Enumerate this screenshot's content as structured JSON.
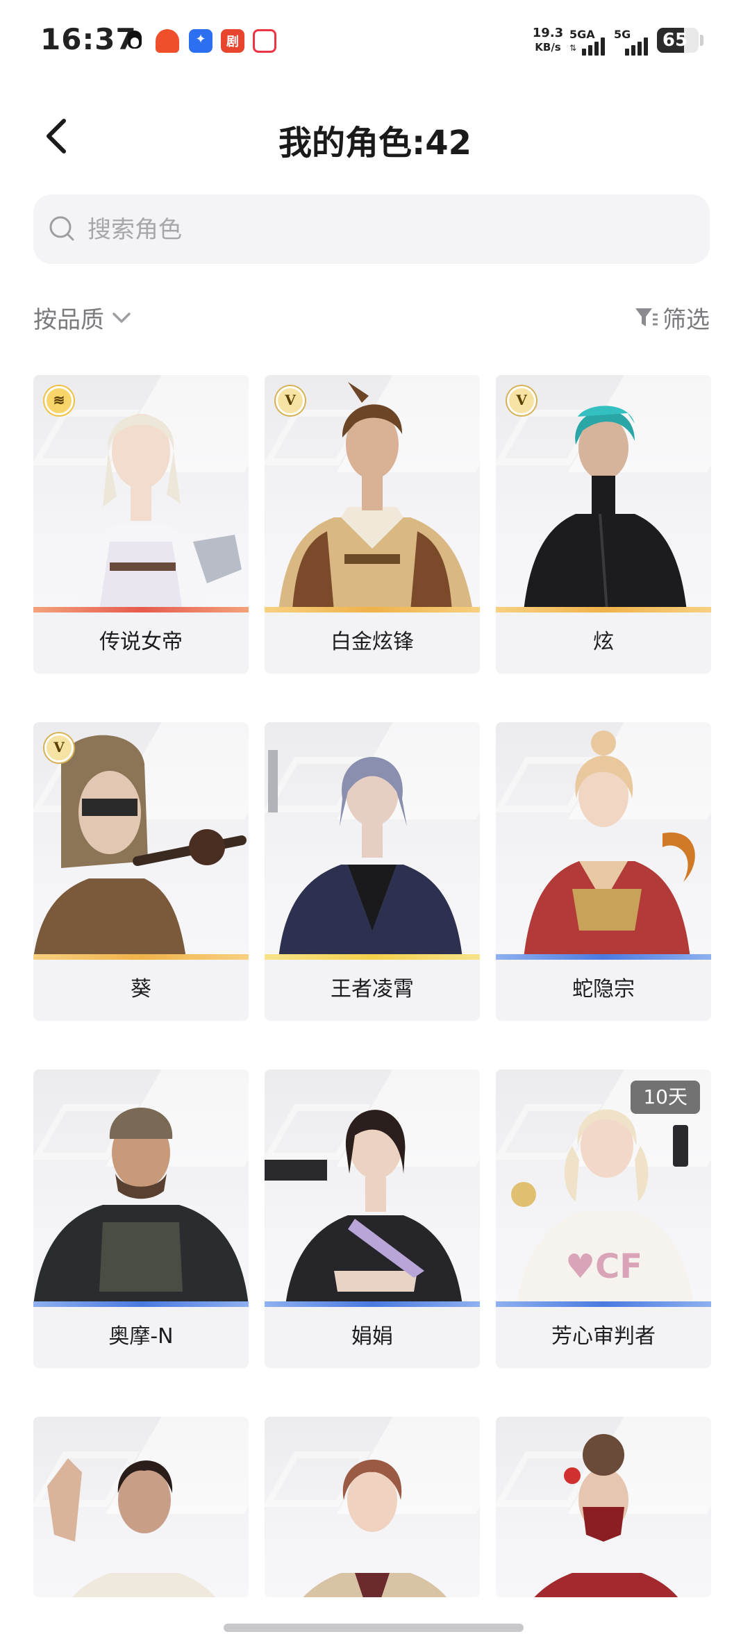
{
  "status_bar": {
    "time": "16:37",
    "net_speed": "19.3",
    "net_unit": "KB/s",
    "sim1": "5GA",
    "sim2": "5G",
    "battery": "65",
    "battery_level": 0.65
  },
  "header": {
    "title": "我的角色:42"
  },
  "search": {
    "placeholder": "搜索角色"
  },
  "toolbar": {
    "sort_label": "按品质",
    "filter_label": "筛选"
  },
  "characters": [
    {
      "name": "传说女帝",
      "badge": "legend",
      "accent": "#e65a4e"
    },
    {
      "name": "白金炫锋",
      "badge": "V",
      "accent": "#f0b24a"
    },
    {
      "name": "炫",
      "badge": "V",
      "accent": "#f0b24a"
    },
    {
      "name": "葵",
      "badge": "V",
      "accent": "#f0b24a"
    },
    {
      "name": "王者凌霄",
      "badge": "",
      "accent": "#f3cf4a"
    },
    {
      "name": "蛇隐宗",
      "badge": "",
      "accent": "#4a7ae0"
    },
    {
      "name": "奥摩-N",
      "badge": "",
      "accent": "#4a7ae0"
    },
    {
      "name": "娟娟",
      "badge": "",
      "accent": "#4a7ae0"
    },
    {
      "name": "芳心审判者",
      "badge": "",
      "accent": "#4a7ae0",
      "tag": "10天"
    },
    {
      "name": "",
      "badge": "",
      "accent": ""
    },
    {
      "name": "",
      "badge": "",
      "accent": ""
    },
    {
      "name": "",
      "badge": "",
      "accent": ""
    }
  ],
  "colors": {
    "background": "#ffffff",
    "card": "#f3f3f5",
    "muted_text": "#7a7a7e",
    "gold_badge": "#f4d27a",
    "legend_accent": "#e65a4e",
    "gold_accent": "#f0b24a",
    "blue_accent": "#4a7ae0"
  }
}
